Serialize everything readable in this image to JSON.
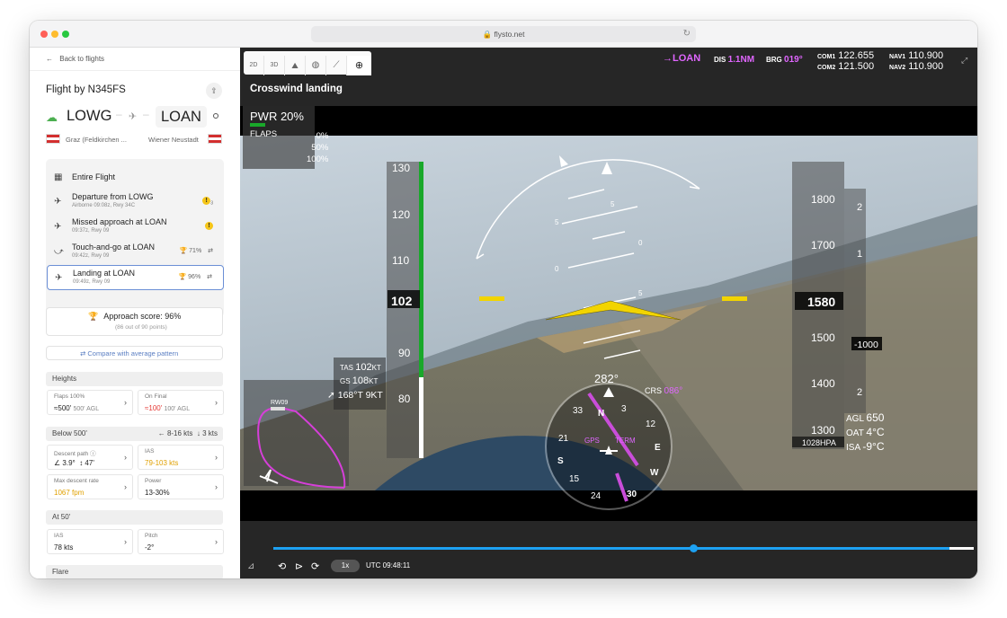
{
  "browser": {
    "url": "flysto.net"
  },
  "sidebar": {
    "back_label": "Back to flights",
    "flight_title": "Flight by N345FS",
    "origin": "LOWG",
    "destination": "LOAN",
    "origin_name": "Graz (Feldkirchen ...",
    "destination_name": "Wiener Neustadt",
    "entire_flight": "Entire Flight",
    "phases": [
      {
        "title": "Departure from LOWG",
        "sub": "Airborne 09:08z, Rwy 34C",
        "badge": "3"
      },
      {
        "title": "Missed approach at LOAN",
        "sub": "09:37z, Rwy 09",
        "badge": ""
      },
      {
        "title": "Touch-and-go at LOAN",
        "sub": "09:42z, Rwy 09",
        "score": "71%"
      },
      {
        "title": "Landing at LOAN",
        "sub": "09:49z, Rwy 09",
        "score": "96%"
      }
    ],
    "approach_score": "Approach score: 96%",
    "approach_points": "(86 out of 90 points)",
    "compare_label": "Compare with average pattern",
    "heights_title": "Heights",
    "flaps_label": "Flaps 100%",
    "flaps_value": "≈500'",
    "flaps_agl": "500' AGL",
    "onfinal_label": "On Final",
    "onfinal_value": "≈100'",
    "onfinal_agl": "100' AGL",
    "below500_title": "Below 500'",
    "wind_a": "8-16 kts",
    "wind_b": "3 kts",
    "descent_label": "Descent path",
    "descent_angle": "3.9°",
    "descent_height": "47'",
    "ias_label": "IAS",
    "ias_value": "79-103 kts",
    "maxrate_label": "Max descent rate",
    "maxrate_value": "1067 fpm",
    "power_label": "Power",
    "power_value": "13-30%",
    "at50_title": "At 50'",
    "ias50_label": "IAS",
    "ias50_value": "78 kts",
    "pitch_label": "Pitch",
    "pitch_value": "-2°",
    "flare_title": "Flare"
  },
  "toolbar": {
    "buttons": [
      "2D",
      "3D"
    ]
  },
  "nav_header": {
    "to": "LOAN",
    "dis_label": "DIS",
    "dis_value": "1.1NM",
    "brg_label": "BRG",
    "brg_value": "019°",
    "com1_label": "COM1",
    "com1": "122.655",
    "com2_label": "COM2",
    "com2": "121.500",
    "nav1_label": "NAV1",
    "nav1": "110.900",
    "nav2_label": "NAV2",
    "nav2": "110.900"
  },
  "scene_title": "Crosswind landing",
  "pfd": {
    "pwr": "PWR 20%",
    "flaps_label": "FLAPS",
    "flaps_opts": [
      "0%",
      "50%",
      "100%"
    ],
    "airspeed_ticks": [
      "130",
      "120",
      "110",
      "90",
      "80"
    ],
    "airspeed_current": "102",
    "tas_label": "TAS",
    "tas": "102",
    "gs_label": "GS",
    "gs": "108",
    "kt": "KT",
    "wind": "168°T 9KT",
    "alt_ticks": [
      "1800",
      "1700",
      "1500",
      "1400",
      "1300"
    ],
    "alt_current": "1580",
    "baro": "1028HPA",
    "vs_ticks": [
      "2",
      "1",
      "1",
      "2"
    ],
    "vs_current": "-1000",
    "heading": "282°",
    "crs_label": "CRS",
    "crs": "086°",
    "gps_label": "GPS",
    "term_label": "TERM",
    "agl_label": "AGL",
    "agl": "650",
    "oat_label": "OAT",
    "oat": "4°C",
    "isa_label": "ISA",
    "isa": "-9°C",
    "runway_label": "RW09",
    "pitch_marks": [
      "5",
      "5",
      "0",
      "0",
      "5"
    ],
    "compass_labels": [
      "33",
      "N",
      "3",
      "E",
      "12",
      "15",
      "S",
      "21",
      "24",
      "W",
      "30"
    ]
  },
  "player": {
    "speed": "1x",
    "time": "UTC 09:48:11",
    "progress": 0.6
  }
}
